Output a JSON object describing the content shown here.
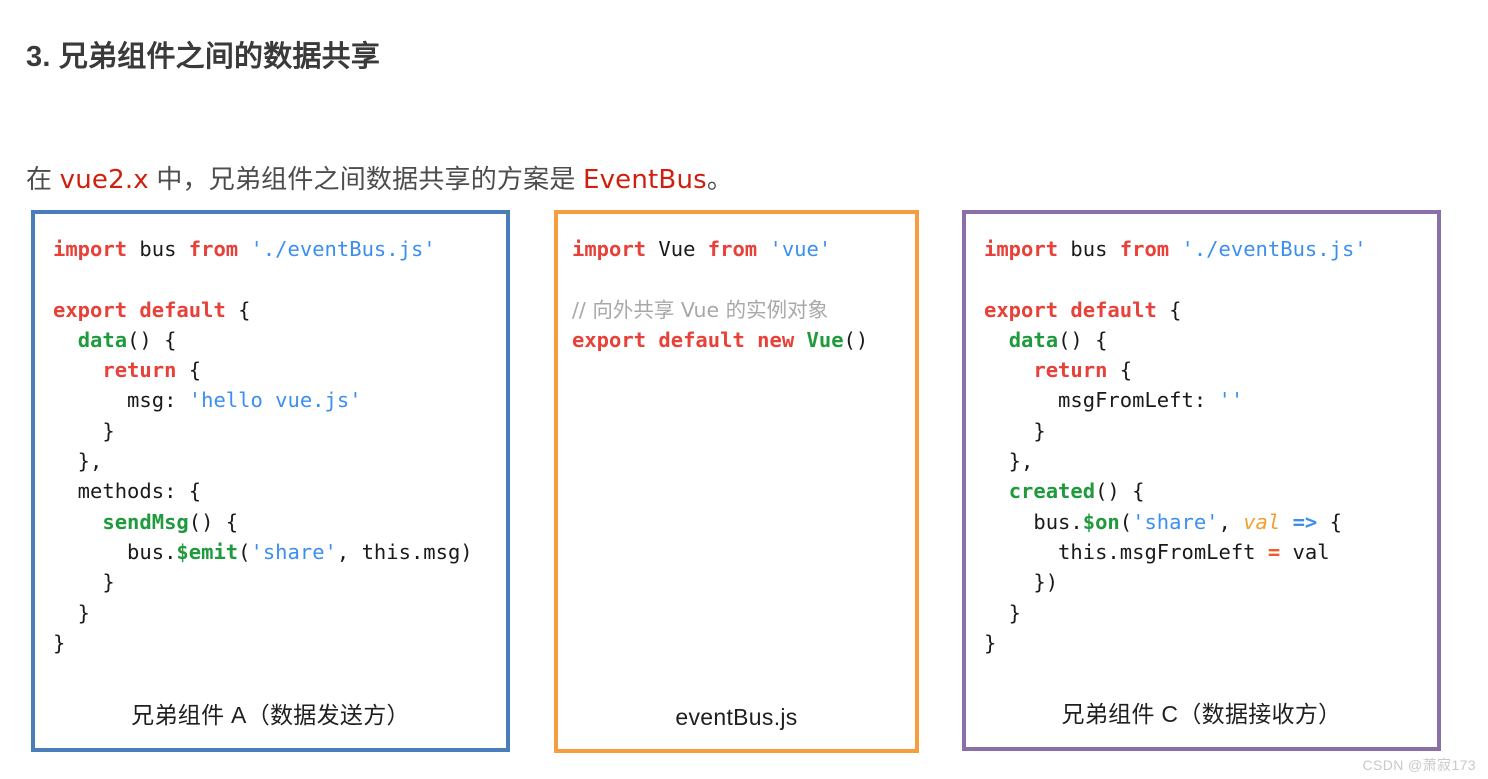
{
  "heading": "3. 兄弟组件之间的数据共享",
  "intro": {
    "before": "在 ",
    "keyword1": "vue2.x",
    "middle": " 中，兄弟组件之间数据共享的方案是 ",
    "keyword2": "EventBus",
    "after": "。"
  },
  "cards": [
    {
      "id": "component-a",
      "border_color": "#4a7ebb",
      "caption": "兄弟组件 A（数据发送方）",
      "code_lines": [
        [
          {
            "t": "import",
            "c": "kw"
          },
          {
            "t": " bus ",
            "c": "plain"
          },
          {
            "t": "from",
            "c": "kw"
          },
          {
            "t": " ",
            "c": "plain"
          },
          {
            "t": "'./eventBus.js'",
            "c": "str"
          }
        ],
        [],
        [
          {
            "t": "export default",
            "c": "kw"
          },
          {
            "t": " {",
            "c": "plain"
          }
        ],
        [
          {
            "t": "  ",
            "c": "plain"
          },
          {
            "t": "data",
            "c": "fn"
          },
          {
            "t": "() {",
            "c": "plain"
          }
        ],
        [
          {
            "t": "    ",
            "c": "plain"
          },
          {
            "t": "return",
            "c": "kw"
          },
          {
            "t": " {",
            "c": "plain"
          }
        ],
        [
          {
            "t": "      msg: ",
            "c": "plain"
          },
          {
            "t": "'hello vue.js'",
            "c": "str"
          }
        ],
        [
          {
            "t": "    }",
            "c": "plain"
          }
        ],
        [
          {
            "t": "  },",
            "c": "plain"
          }
        ],
        [
          {
            "t": "  methods: {",
            "c": "plain"
          }
        ],
        [
          {
            "t": "    ",
            "c": "plain"
          },
          {
            "t": "sendMsg",
            "c": "fn"
          },
          {
            "t": "() {",
            "c": "plain"
          }
        ],
        [
          {
            "t": "      bus.",
            "c": "plain"
          },
          {
            "t": "$emit",
            "c": "fn"
          },
          {
            "t": "(",
            "c": "plain"
          },
          {
            "t": "'share'",
            "c": "str"
          },
          {
            "t": ", this.msg)",
            "c": "plain"
          }
        ],
        [
          {
            "t": "    }",
            "c": "plain"
          }
        ],
        [
          {
            "t": "  }",
            "c": "plain"
          }
        ],
        [
          {
            "t": "}",
            "c": "plain"
          }
        ]
      ]
    },
    {
      "id": "event-bus",
      "border_color": "#f59d3f",
      "caption": "eventBus.js",
      "code_lines": [
        [
          {
            "t": "import",
            "c": "kw"
          },
          {
            "t": " Vue ",
            "c": "plain"
          },
          {
            "t": "from",
            "c": "kw"
          },
          {
            "t": " ",
            "c": "plain"
          },
          {
            "t": "'vue'",
            "c": "str"
          }
        ],
        [],
        [
          {
            "t": "// 向外共享 Vue 的实例对象",
            "c": "comment-cjk"
          }
        ],
        [
          {
            "t": "export default new",
            "c": "kw"
          },
          {
            "t": " ",
            "c": "plain"
          },
          {
            "t": "Vue",
            "c": "fn"
          },
          {
            "t": "()",
            "c": "plain"
          }
        ]
      ]
    },
    {
      "id": "component-c",
      "border_color": "#8a6fa8",
      "caption": "兄弟组件 C（数据接收方）",
      "code_lines": [
        [
          {
            "t": "import",
            "c": "kw"
          },
          {
            "t": " bus ",
            "c": "plain"
          },
          {
            "t": "from",
            "c": "kw"
          },
          {
            "t": " ",
            "c": "plain"
          },
          {
            "t": "'./eventBus.js'",
            "c": "str"
          }
        ],
        [],
        [
          {
            "t": "export default",
            "c": "kw"
          },
          {
            "t": " {",
            "c": "plain"
          }
        ],
        [
          {
            "t": "  ",
            "c": "plain"
          },
          {
            "t": "data",
            "c": "fn"
          },
          {
            "t": "() {",
            "c": "plain"
          }
        ],
        [
          {
            "t": "    ",
            "c": "plain"
          },
          {
            "t": "return",
            "c": "kw"
          },
          {
            "t": " {",
            "c": "plain"
          }
        ],
        [
          {
            "t": "      msgFromLeft: ",
            "c": "plain"
          },
          {
            "t": "''",
            "c": "str"
          }
        ],
        [
          {
            "t": "    }",
            "c": "plain"
          }
        ],
        [
          {
            "t": "  },",
            "c": "plain"
          }
        ],
        [
          {
            "t": "  ",
            "c": "plain"
          },
          {
            "t": "created",
            "c": "fn"
          },
          {
            "t": "() {",
            "c": "plain"
          }
        ],
        [
          {
            "t": "    bus.",
            "c": "plain"
          },
          {
            "t": "$on",
            "c": "fn"
          },
          {
            "t": "(",
            "c": "plain"
          },
          {
            "t": "'share'",
            "c": "str"
          },
          {
            "t": ", ",
            "c": "plain"
          },
          {
            "t": "val",
            "c": "param"
          },
          {
            "t": " ",
            "c": "plain"
          },
          {
            "t": "=>",
            "c": "arrow"
          },
          {
            "t": " {",
            "c": "plain"
          }
        ],
        [
          {
            "t": "      this.msgFromLeft ",
            "c": "plain"
          },
          {
            "t": "=",
            "c": "op"
          },
          {
            "t": " val",
            "c": "plain"
          }
        ],
        [
          {
            "t": "    })",
            "c": "plain"
          }
        ],
        [
          {
            "t": "  }",
            "c": "plain"
          }
        ],
        [
          {
            "t": "}",
            "c": "plain"
          }
        ]
      ]
    }
  ],
  "watermark": "CSDN @萧寂173"
}
